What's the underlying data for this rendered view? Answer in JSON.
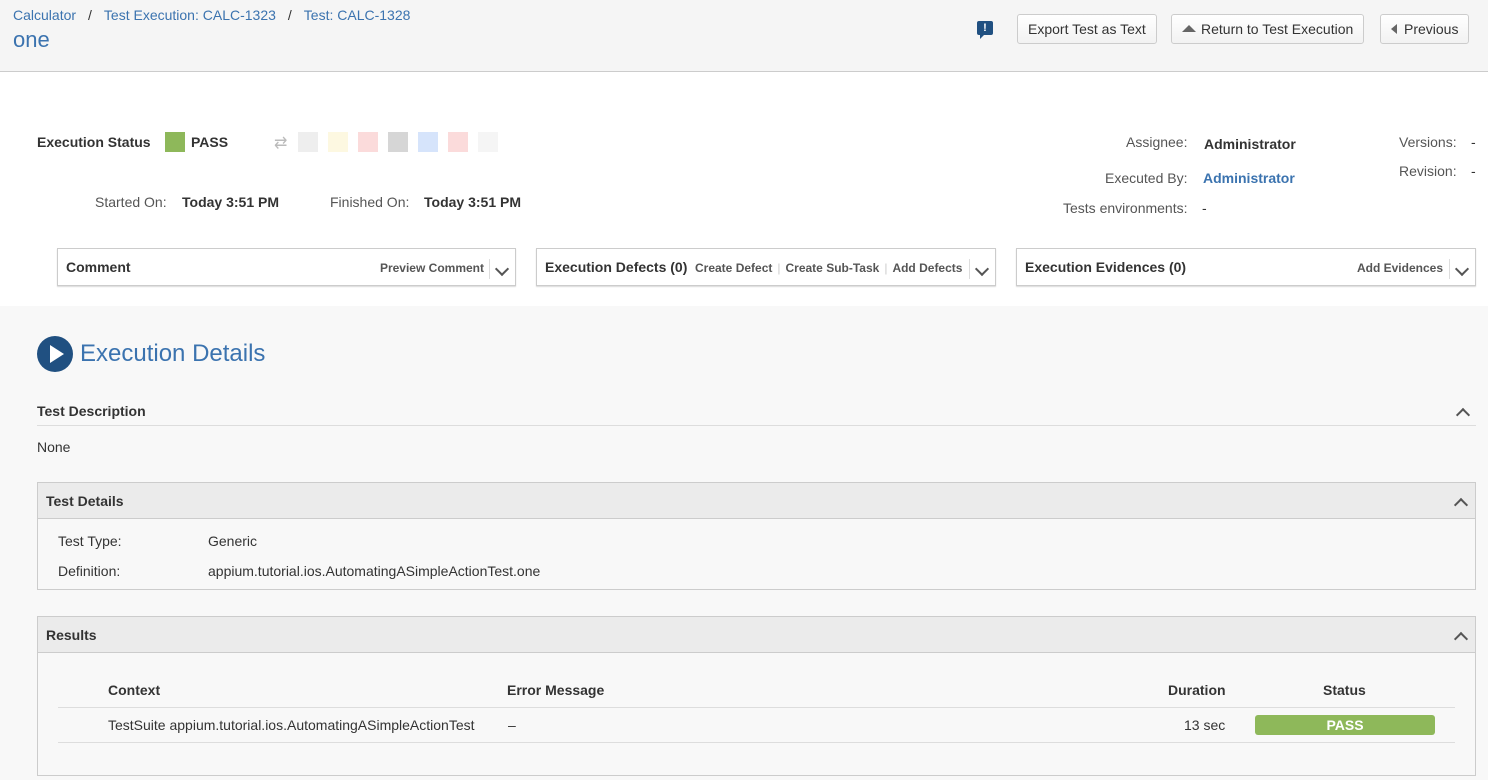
{
  "header": {
    "breadcrumbs": [
      "Calculator",
      "Test Execution: CALC-1323",
      "Test: CALC-1328"
    ],
    "title": "one",
    "feedback_icon": "!",
    "export_button": "Export Test as Text",
    "return_button": "Return to Test Execution",
    "previous_button": "Previous"
  },
  "summary": {
    "execution_status_label": "Execution Status",
    "execution_status_value": "PASS",
    "status_color": "#8eb85a",
    "status_swatches": [
      "#eeeeee",
      "#fdf8e1",
      "#fbdbdb",
      "#d6d6d6",
      "#d6e4fb",
      "#fbdbdb",
      "#f5f5f5"
    ],
    "started_on_label": "Started On:",
    "started_on_value": "Today 3:51 PM",
    "finished_on_label": "Finished On:",
    "finished_on_value": "Today 3:51 PM",
    "assignee_label": "Assignee:",
    "assignee_value": "Administrator",
    "executed_by_label": "Executed By:",
    "executed_by_value": "Administrator",
    "tests_env_label": "Tests environments:",
    "tests_env_value": "-",
    "versions_label": "Versions:",
    "versions_value": "-",
    "revision_label": "Revision:",
    "revision_value": "-"
  },
  "panels": {
    "comment_title": "Comment",
    "preview_comment": "Preview Comment",
    "defects_title": "Execution Defects (0)",
    "create_defect": "Create Defect",
    "create_subtask": "Create Sub-Task",
    "add_defects": "Add Defects",
    "evidences_title": "Execution Evidences (0)",
    "add_evidences": "Add Evidences"
  },
  "details": {
    "section_title": "Execution Details",
    "description_title": "Test Description",
    "description_value": "None",
    "test_details_title": "Test Details",
    "test_type_label": "Test Type:",
    "test_type_value": "Generic",
    "definition_label": "Definition:",
    "definition_value": "appium.tutorial.ios.AutomatingASimpleActionTest.one"
  },
  "results": {
    "title": "Results",
    "columns": [
      "Context",
      "Error Message",
      "Duration",
      "Status"
    ],
    "rows": [
      {
        "context": "TestSuite appium.tutorial.ios.AutomatingASimpleActionTest",
        "error": "–",
        "duration": "13 sec",
        "status": "PASS"
      }
    ]
  }
}
